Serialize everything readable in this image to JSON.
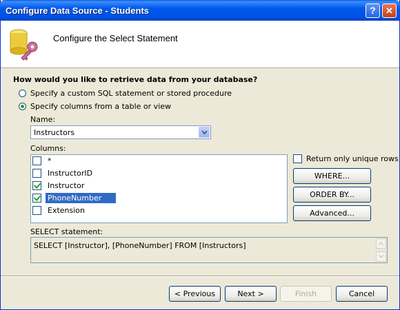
{
  "window": {
    "title": "Configure Data Source - Students"
  },
  "header": {
    "title": "Configure the Select Statement"
  },
  "question": "How would you like to retrieve data from your database?",
  "options": [
    {
      "label": "Specify a custom SQL statement or stored procedure",
      "checked": false
    },
    {
      "label": "Specify columns from a table or view",
      "checked": true
    }
  ],
  "name_label": "Name:",
  "name_value": "Instructors",
  "columns_label": "Columns:",
  "columns": [
    {
      "label": "*",
      "checked": false,
      "selected": false
    },
    {
      "label": "InstructorID",
      "checked": false,
      "selected": false
    },
    {
      "label": "Instructor",
      "checked": true,
      "selected": false
    },
    {
      "label": "PhoneNumber",
      "checked": true,
      "selected": true
    },
    {
      "label": "Extension",
      "checked": false,
      "selected": false
    }
  ],
  "unique_rows_label": "Return only unique rows",
  "side_buttons": {
    "where": "WHERE...",
    "order_by": "ORDER BY...",
    "advanced": "Advanced..."
  },
  "select_label": "SELECT statement:",
  "select_text": "SELECT [Instructor], [PhoneNumber] FROM [Instructors]",
  "footer": {
    "previous": "< Previous",
    "next": "Next >",
    "finish": "Finish",
    "cancel": "Cancel"
  }
}
